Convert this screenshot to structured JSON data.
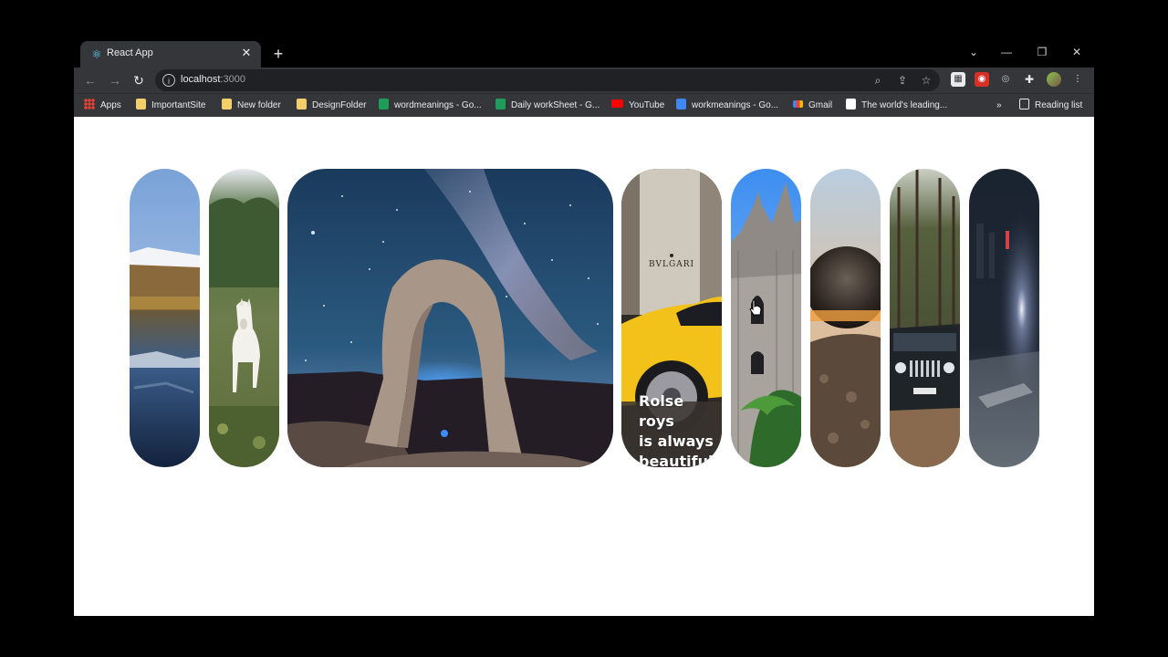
{
  "browser": {
    "tab_title": "React App",
    "url_host": "localhost",
    "url_port": ":3000",
    "bookmarks": [
      {
        "label": "Apps",
        "icon": "apps-grid-icon"
      },
      {
        "label": "ImportantSite",
        "icon": "folder-icon"
      },
      {
        "label": "New folder",
        "icon": "folder-icon"
      },
      {
        "label": "DesignFolder",
        "icon": "folder-icon"
      },
      {
        "label": "wordmeanings - Go...",
        "icon": "sheets-icon"
      },
      {
        "label": "Daily workSheet - G...",
        "icon": "sheets-icon"
      },
      {
        "label": "YouTube",
        "icon": "youtube-icon"
      },
      {
        "label": "workmeanings - Go...",
        "icon": "docs-icon"
      },
      {
        "label": "Gmail",
        "icon": "gmail-icon"
      },
      {
        "label": "The world's leading...",
        "icon": "github-icon"
      }
    ],
    "bookmarks_overflow": "»",
    "reading_list": "Reading list"
  },
  "gallery": {
    "cards": [
      {
        "name": "lake-mountain"
      },
      {
        "name": "white-horse"
      },
      {
        "name": "milky-way-arch"
      },
      {
        "name": "yellow-sports-car",
        "caption_lines": [
          "Rolse roys",
          "is always",
          "beautiful"
        ],
        "sign_text": "BVLGARI"
      },
      {
        "name": "gothic-cathedral"
      },
      {
        "name": "crystal-ball"
      },
      {
        "name": "jeep-forest"
      },
      {
        "name": "night-street"
      }
    ]
  }
}
